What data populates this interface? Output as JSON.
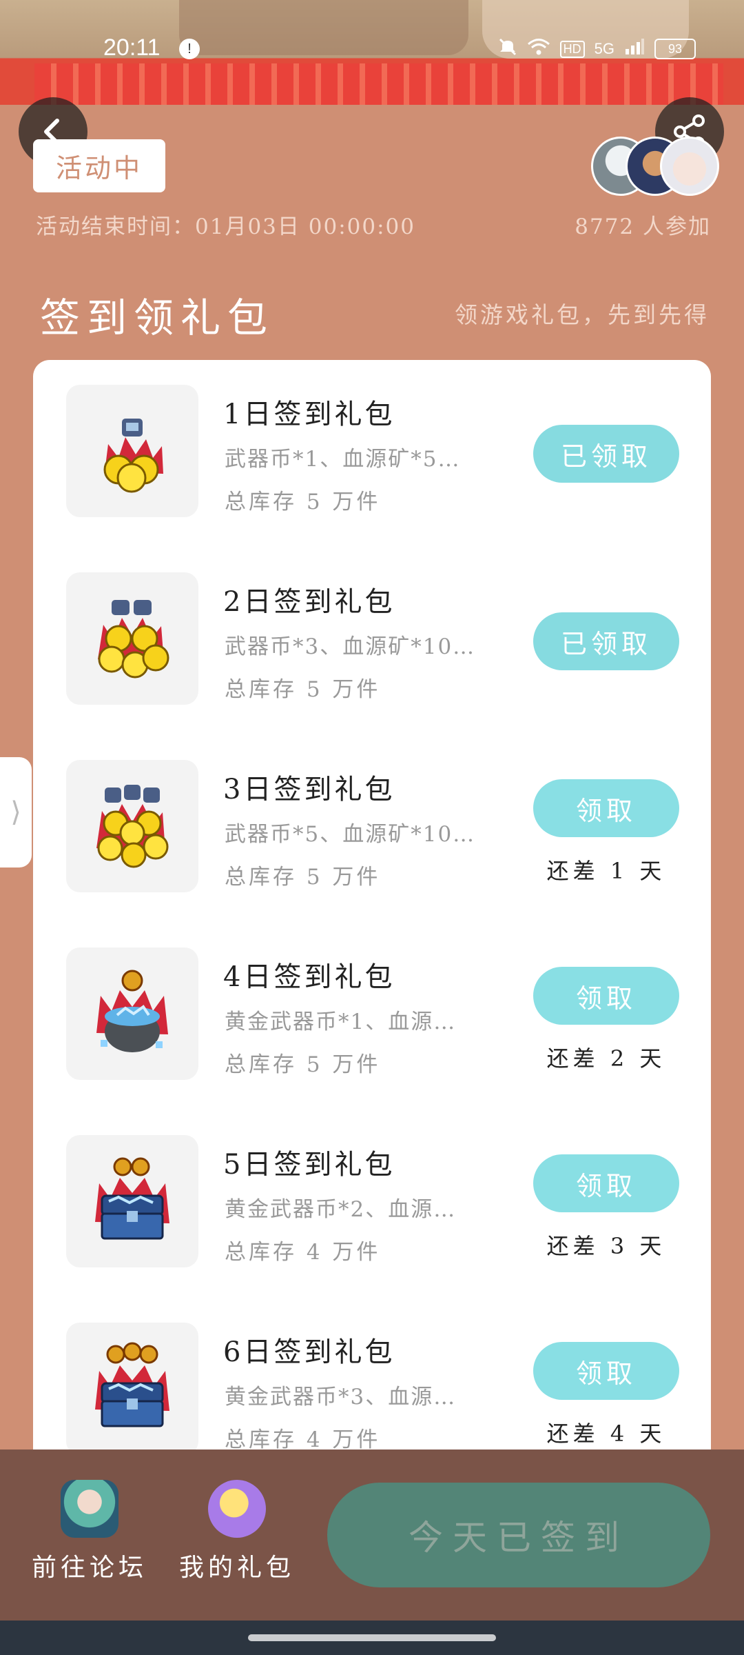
{
  "status_bar": {
    "time": "20:11",
    "notification_badge": "!",
    "hd_label": "HD",
    "network_label": "5G",
    "battery": "93"
  },
  "header": {
    "tag": "活动中",
    "end_time": "活动结束时间：01月03日 00:00:00",
    "participants": "8772 人参加"
  },
  "section": {
    "title": "签到领礼包",
    "subtitle": "领游戏礼包，先到先得"
  },
  "gifts": [
    {
      "title": "1日签到礼包",
      "desc": "武器币*1、血源矿*5…",
      "stock": "总库存 5 万件",
      "button": "已领取",
      "remaining": "",
      "icon": "coin-pile-icon"
    },
    {
      "title": "2日签到礼包",
      "desc": "武器币*3、血源矿*10…",
      "stock": "总库存 5 万件",
      "button": "已领取",
      "remaining": "",
      "icon": "coin-pile-icon"
    },
    {
      "title": "3日签到礼包",
      "desc": "武器币*5、血源矿*10…",
      "stock": "总库存 5 万件",
      "button": "领取",
      "remaining": "还差 1 天",
      "icon": "coin-pile-icon"
    },
    {
      "title": "4日签到礼包",
      "desc": "黄金武器币*1、血源…",
      "stock": "总库存 5 万件",
      "button": "领取",
      "remaining": "还差 2 天",
      "icon": "ore-pot-icon"
    },
    {
      "title": "5日签到礼包",
      "desc": "黄金武器币*2、血源…",
      "stock": "总库存 4 万件",
      "button": "领取",
      "remaining": "还差 3 天",
      "icon": "treasure-chest-icon"
    },
    {
      "title": "6日签到礼包",
      "desc": "黄金武器币*3、血源…",
      "stock": "总库存 4 万件",
      "button": "领取",
      "remaining": "还差 4 天",
      "icon": "treasure-chest-icon"
    }
  ],
  "bottom_bar": {
    "forum_label": "前往论坛",
    "my_gifts_label": "我的礼包",
    "signin_label": "今天已签到"
  },
  "colors": {
    "page_bg": "#cf8f74",
    "button_teal": "#89dfe4",
    "signin_bg": "#538577",
    "bottom_bar": "#7b5448"
  }
}
